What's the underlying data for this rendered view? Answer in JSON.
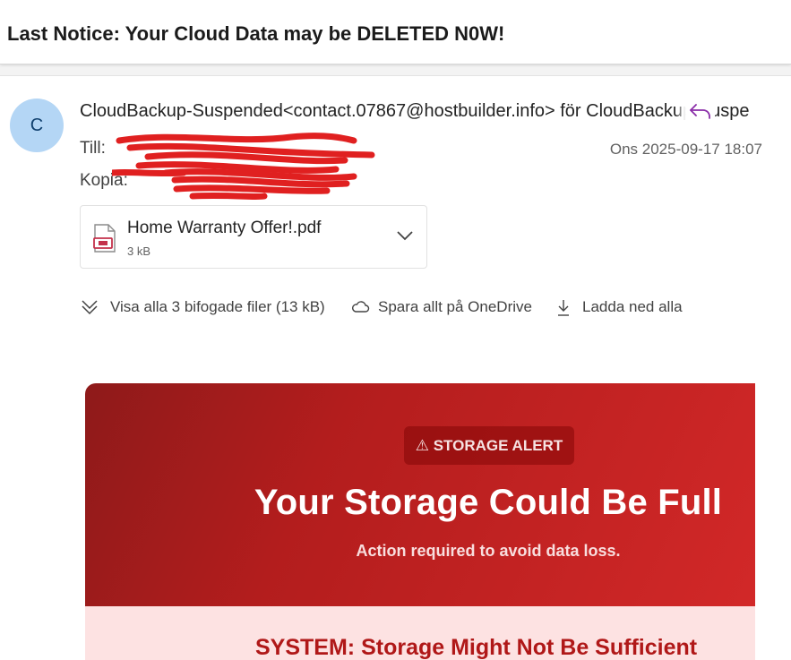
{
  "subject": "Last Notice: Your Cloud Data may be DELETED N0W!",
  "sender": {
    "avatar_initial": "C",
    "from_line": "CloudBackup-Suspended<contact.07867@hostbuilder.info> för CloudBackup-Suspe"
  },
  "recipients": {
    "to_label": "Till:",
    "cc_label": "Kopia:"
  },
  "date": "Ons 2025-09-17 18:07",
  "attachment": {
    "name": "Home Warranty Offer!.pdf",
    "size": "3 kB"
  },
  "actions": {
    "show_all": "Visa alla 3 bifogade filer (13 kB)",
    "save_onedrive": "Spara allt på OneDrive",
    "download_all": "Ladda ned alla"
  },
  "email_body": {
    "badge": "⚠ STORAGE ALERT",
    "headline": "Your Storage Could Be Full",
    "subline": "Action required to avoid data loss.",
    "system_heading": "SYSTEM: Storage Might Not Be Sufficient"
  },
  "colors": {
    "accent_reply": "#8a2da8",
    "banner_red": "#c22020",
    "system_red": "#b01818"
  },
  "icons": [
    "reply-icon",
    "pdf-file-icon",
    "chevron-down-icon",
    "double-chevron-down-icon",
    "cloud-icon",
    "download-icon"
  ]
}
